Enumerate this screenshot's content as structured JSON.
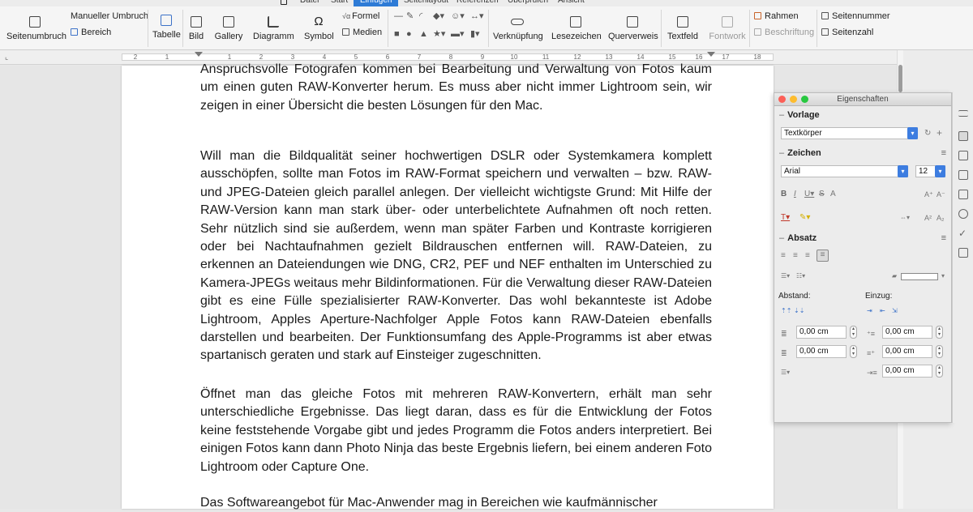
{
  "menu": {
    "tabs": [
      "Datei",
      "Start",
      "Einfügen",
      "Seitenlayout",
      "Referenzen",
      "Überprüfen",
      "Ansicht"
    ],
    "active": "Einfügen"
  },
  "ribbon": {
    "seitenumbruch": "Seitenumbruch",
    "manueller_umbruch": "Manueller Umbruch",
    "bereich": "Bereich",
    "tabelle": "Tabelle",
    "bild": "Bild",
    "gallery": "Gallery",
    "diagramm": "Diagramm",
    "symbol": "Symbol",
    "formel": "Formel",
    "medien": "Medien",
    "verknuepfung": "Verknüpfung",
    "lesezeichen": "Lesezeichen",
    "querverweis": "Querverweis",
    "textfeld": "Textfeld",
    "fontwork": "Fontwork",
    "rahmen": "Rahmen",
    "beschriftung": "Beschriftung",
    "seitennummer": "Seitennummer",
    "seitenzahl": "Seitenzahl"
  },
  "ruler": {
    "labels": [
      "2",
      "1",
      "1",
      "2",
      "3",
      "4",
      "5",
      "6",
      "7",
      "8",
      "9",
      "10",
      "11",
      "12",
      "13",
      "14",
      "15",
      "16",
      "17",
      "18"
    ]
  },
  "document": {
    "paragraphs": [
      "Anspruchsvolle Fotografen kommen bei Bearbeitung und Verwaltung von Fotos kaum um einen guten RAW-Konverter herum. Es muss aber nicht immer Lightroom sein, wir zeigen in einer Übersicht die besten Lösungen für den Mac.",
      "Will man die Bildqualität seiner hochwertigen DSLR oder Systemkamera komplett ausschöpfen, sollte man Fotos im RAW-Format speichern und verwalten – bzw. RAW- und JPEG-Dateien gleich parallel anlegen. Der vielleicht wichtigste Grund: Mit Hilfe der RAW-Version kann man stark über- oder unterbelichtete Aufnahmen oft noch retten. Sehr nützlich sind sie außerdem, wenn man später Farben und Kontraste korrigieren oder bei Nachtaufnahmen gezielt Bildrauschen entfernen will. RAW-Dateien, zu erkennen an Dateiendungen wie DNG, CR2, PEF und NEF enthalten im Unterschied zu Kamera-JPEGs weitaus mehr Bildinformationen. Für die Verwaltung dieser RAW-Dateien gibt es eine Fülle spezialisierter RAW-Konverter. Das wohl bekannteste ist Adobe Lightroom, Apples Aperture-Nachfolger Apple Fotos kann RAW-Dateien ebenfalls darstellen und bearbeiten. Der Funktionsumfang des Apple-Programms ist aber etwas spartanisch geraten und stark auf Einsteiger zugeschnitten.",
      "Öffnet man das gleiche Fotos mit mehreren RAW-Konvertern, erhält man sehr unterschiedliche Ergebnisse. Das liegt daran, dass es für die Entwicklung der Fotos keine feststehende Vorgabe gibt und jedes Programm die Fotos anders interpretiert. Bei einigen Fotos kann dann Photo Ninja das beste Ergebnis liefern, bei einem anderen Foto Lightroom oder Capture One.",
      "Das Softwareangebot für Mac-Anwender mag in Bereichen wie kaufmännischer"
    ]
  },
  "panel": {
    "title": "Eigenschaften",
    "vorlage_heading": "Vorlage",
    "style_value": "Textkörper",
    "zeichen_heading": "Zeichen",
    "font_value": "Arial",
    "size_value": "12",
    "absatz_heading": "Absatz",
    "abstand_label": "Abstand:",
    "einzug_label": "Einzug:",
    "abstand_oben": "0,00 cm",
    "abstand_unten": "0,00 cm",
    "einzug_vor": "0,00 cm",
    "einzug_nach": "0,00 cm",
    "einzug_erste": "0,00 cm"
  }
}
